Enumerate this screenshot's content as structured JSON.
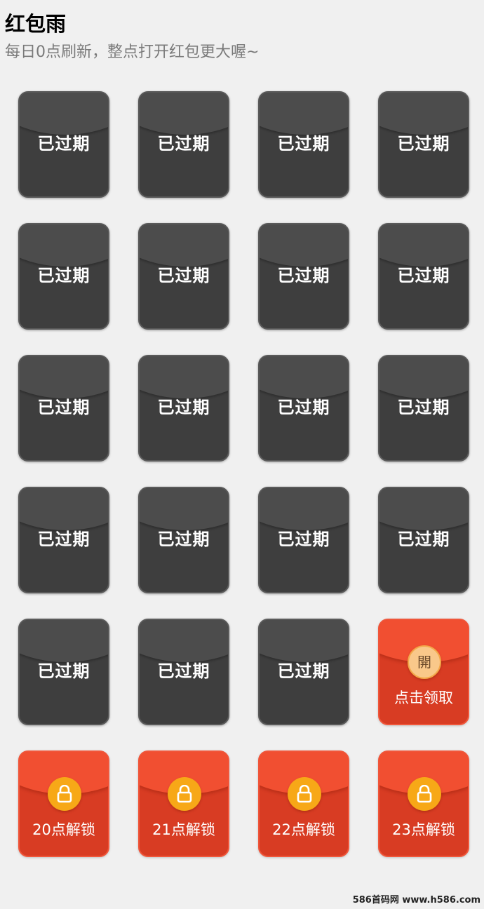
{
  "header": {
    "title": "红包雨",
    "subtitle": "每日0点刷新，整点打开红包更大喔~"
  },
  "expired_label": "已过期",
  "claim": {
    "icon_char": "開",
    "label": "点击领取"
  },
  "locked": [
    {
      "label": "20点解锁",
      "icon": "lock-icon"
    },
    {
      "label": "21点解锁",
      "icon": "lock-icon"
    },
    {
      "label": "22点解锁",
      "icon": "lock-icon"
    },
    {
      "label": "23点解锁",
      "icon": "lock-icon"
    }
  ],
  "expired_count": 19,
  "watermark": "586首码网 www.h586.com",
  "colors": {
    "expired_bg": "#3e3e3e",
    "red_bg": "#d83c23",
    "red_flap": "#f14f31",
    "coin": "#f7a817"
  }
}
